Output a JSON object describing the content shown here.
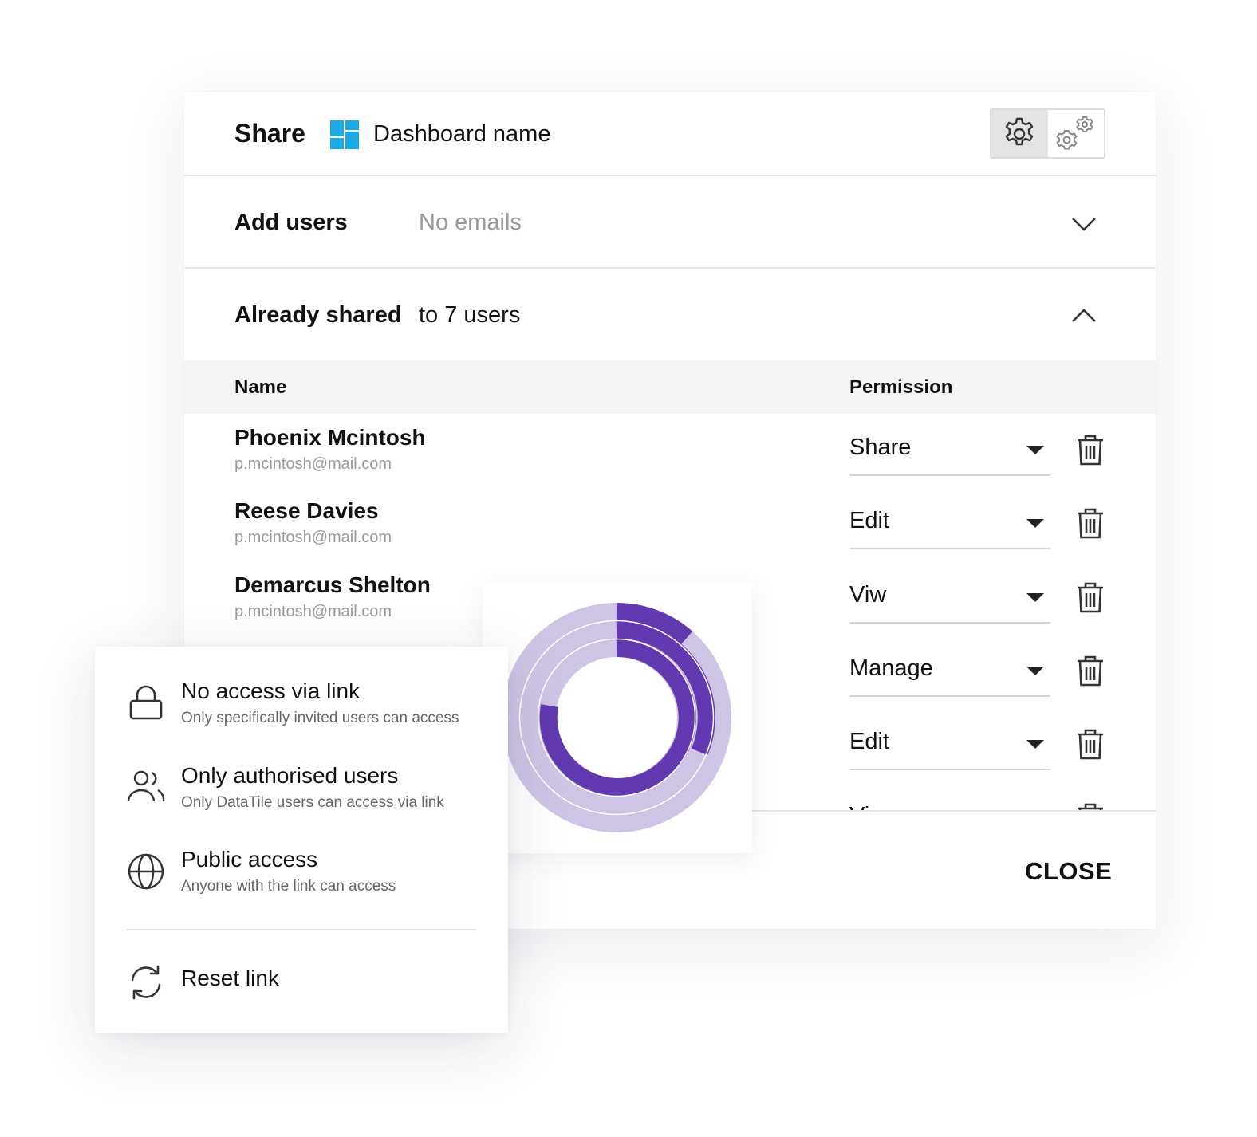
{
  "header": {
    "title": "Share",
    "dashboard_name": "Dashboard name",
    "logo_color": "#1BA9E4",
    "toggle": [
      {
        "icon": "gear-icon",
        "active": true
      },
      {
        "icon": "gears-icon",
        "active": false
      }
    ]
  },
  "add_users": {
    "label": "Add users",
    "value": "No emails"
  },
  "already_shared": {
    "label": "Already shared",
    "value": "to 7 users"
  },
  "table": {
    "col_name": "Name",
    "col_permission": "Permission",
    "rows": [
      {
        "name": "Phoenix Mcintosh",
        "email": "p.mcintosh@mail.com",
        "permission": "Share"
      },
      {
        "name": "Reese Davies",
        "email": "p.mcintosh@mail.com",
        "permission": "Edit"
      },
      {
        "name": "Demarcus Shelton",
        "email": "p.mcintosh@mail.com",
        "permission": "Viw"
      },
      {
        "name": "",
        "email": "",
        "permission": "Manage"
      },
      {
        "name": "",
        "email": "",
        "permission": "Edit"
      },
      {
        "name": "",
        "email": "",
        "permission": "Viw"
      }
    ]
  },
  "footer": {
    "close_label": "CLOSE"
  },
  "access_menu": {
    "items": [
      {
        "title": "No access via link",
        "subtitle": "Only specifically invited users can access",
        "icon": "lock-icon"
      },
      {
        "title": "Only authorised users",
        "subtitle": "Only DataTile users can access via link",
        "icon": "users-icon"
      },
      {
        "title": "Public access",
        "subtitle": "Anyone with the link can access",
        "icon": "globe-icon"
      }
    ],
    "reset_label": "Reset link"
  },
  "colors": {
    "accent_dark": "#6139B0",
    "accent_light": "#CEC4E6"
  }
}
